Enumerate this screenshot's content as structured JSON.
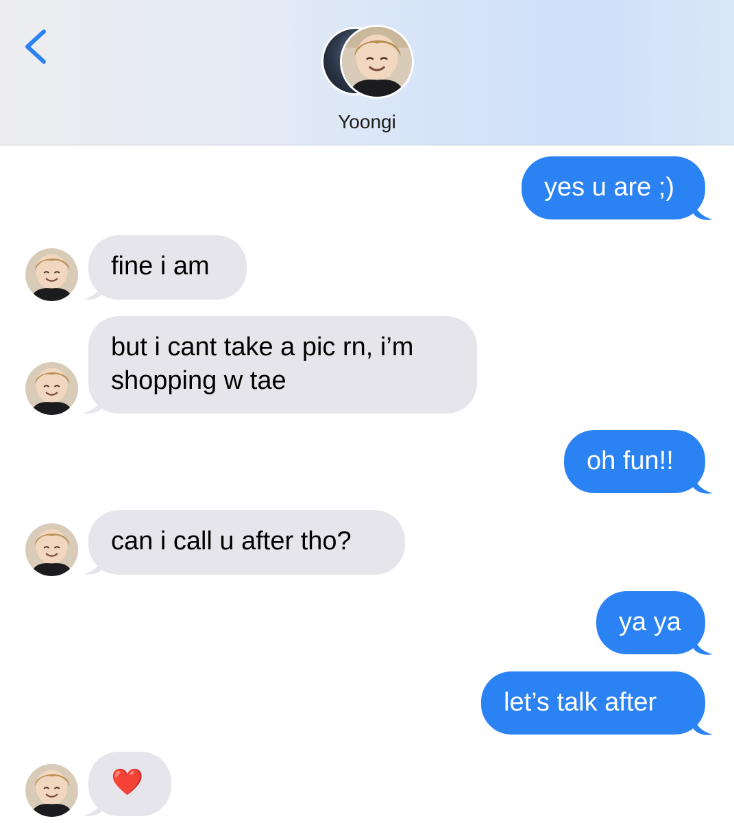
{
  "header": {
    "contact_name": "Yoongi",
    "back_icon": "chevron-left-icon",
    "avatar_icon": "contact-avatar"
  },
  "colors": {
    "outgoing_bubble": "#2b82f3",
    "incoming_bubble": "#e6e5eb",
    "back_accent": "#2b82f3"
  },
  "messages": [
    {
      "direction": "outgoing",
      "text": "yes u are ;)"
    },
    {
      "direction": "incoming",
      "text": "fine i am"
    },
    {
      "direction": "incoming",
      "text_lines": [
        "but i cant take a pic rn, i’m",
        "shopping w tae"
      ]
    },
    {
      "direction": "outgoing",
      "text": "oh fun!!"
    },
    {
      "direction": "incoming",
      "text": "can i call u after tho?"
    },
    {
      "direction": "outgoing",
      "text": "ya ya"
    },
    {
      "direction": "outgoing",
      "text": "let’s talk after"
    },
    {
      "direction": "incoming",
      "text": "❤️"
    }
  ]
}
